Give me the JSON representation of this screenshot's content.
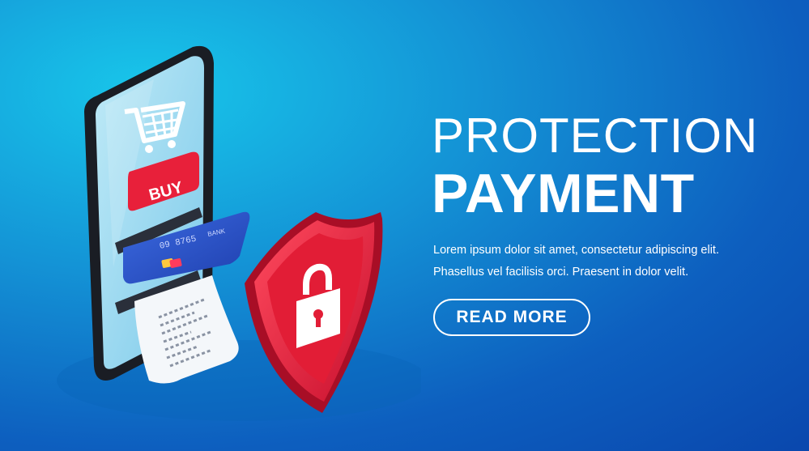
{
  "headline": {
    "line1": "PROTECTION",
    "line2": "PAYMENT"
  },
  "body": {
    "line1": "Lorem ipsum dolor sit amet, consectetur adipiscing elit.",
    "line2": "Phasellus vel facilisis orci. Praesent in dolor velit."
  },
  "cta": {
    "label": "READ MORE"
  },
  "phone": {
    "buy_label": "BUY",
    "card_number": "09 8765",
    "card_bank": "BANK"
  },
  "icons": [
    "shopping-cart-icon",
    "padlock-icon",
    "shield-icon"
  ],
  "colors": {
    "background_start": "#18c6ea",
    "background_end": "#0a47ad",
    "accent_red": "#e8203a",
    "card_blue": "#2a53c9",
    "text": "#ffffff"
  }
}
